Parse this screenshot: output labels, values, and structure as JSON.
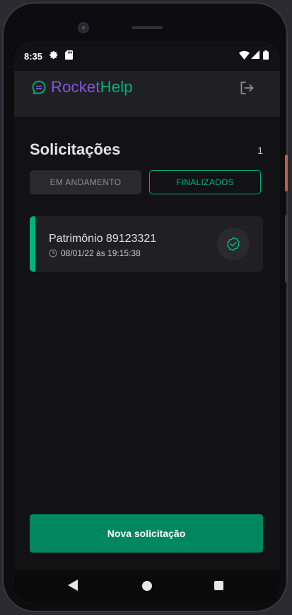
{
  "status_bar": {
    "time": "8:35",
    "icons": [
      "settings-icon",
      "sd-card-icon",
      "wifi-icon",
      "signal-icon",
      "battery-icon"
    ]
  },
  "header": {
    "logo_part1": "Rocket",
    "logo_part2": "Help",
    "logo_icon": "chat-bubble-icon",
    "logout_icon": "sign-out-icon"
  },
  "requests": {
    "title": "Solicitações",
    "count": "1",
    "tabs": [
      {
        "label": "EM ANDAMENTO",
        "selected": false
      },
      {
        "label": "FINALIZADOS",
        "selected": true
      }
    ],
    "items": [
      {
        "name": "Patrimônio 89123321",
        "datetime": "08/01/22 às 19:15:38",
        "status_icon": "circle-wavy-check-icon",
        "status": "closed"
      }
    ]
  },
  "new_request_button": "Nova solicitação",
  "colors": {
    "primary": "#00b37e",
    "button": "#00875f",
    "logo_purple": "#8257e5",
    "background": "#121214",
    "card": "#202024"
  },
  "nav_bar": {
    "icons": [
      "back-icon",
      "home-icon",
      "recents-icon"
    ]
  }
}
